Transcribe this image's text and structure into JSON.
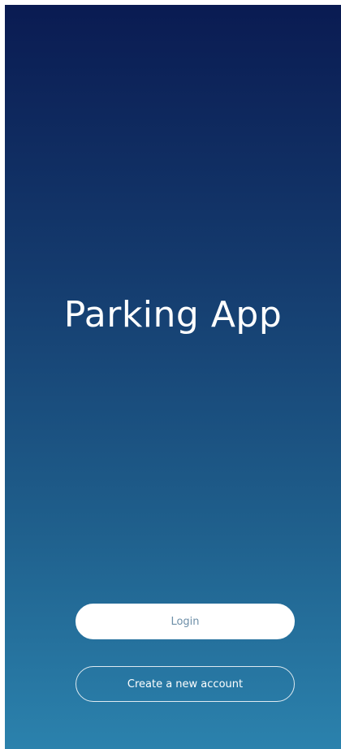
{
  "app": {
    "title": "Parking App"
  },
  "actions": {
    "login_label": "Login",
    "create_account_label": "Create a new account"
  },
  "colors": {
    "gradient_top": "#0a1b52",
    "gradient_bottom": "#2b82ad",
    "login_text": "#6d8fa8",
    "button_outline": "#ffffff"
  }
}
